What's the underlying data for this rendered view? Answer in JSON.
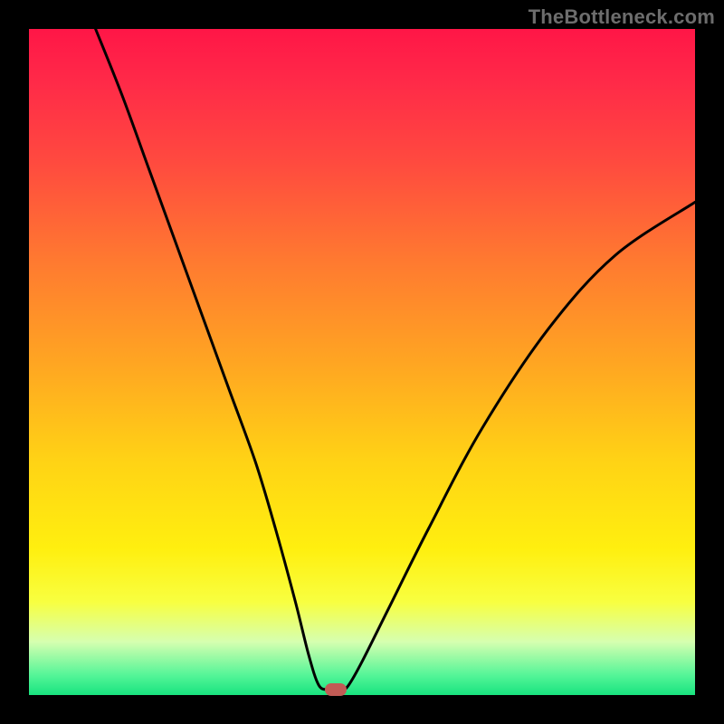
{
  "watermark": "TheBottleneck.com",
  "chart_data": {
    "type": "line",
    "title": "",
    "xlabel": "",
    "ylabel": "",
    "xlim": [
      0,
      100
    ],
    "ylim": [
      0,
      100
    ],
    "grid": false,
    "legend": false,
    "series": [
      {
        "name": "bottleneck-curve",
        "x": [
          10,
          14,
          18,
          22,
          26,
          30,
          34,
          37,
          40,
          42,
          43.5,
          45,
          47,
          48,
          50,
          54,
          60,
          68,
          78,
          88,
          100
        ],
        "y": [
          100,
          90,
          79,
          68,
          57,
          46,
          35,
          25,
          14,
          6,
          1.5,
          0.8,
          0.8,
          1.5,
          5,
          13,
          25,
          40,
          55,
          66,
          74
        ]
      }
    ],
    "marker": {
      "x": 46,
      "y": 0.8,
      "shape": "pill",
      "color": "#c25b55"
    }
  },
  "colors": {
    "border": "#000000",
    "curve": "#000000",
    "gradient_top": "#ff1647",
    "gradient_bottom": "#18e37f"
  }
}
